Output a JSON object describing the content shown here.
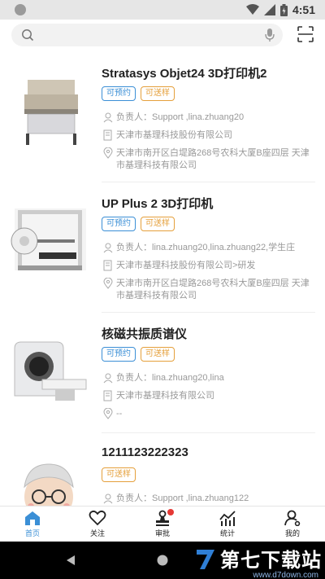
{
  "status_bar": {
    "time": "4:51"
  },
  "search": {
    "placeholder": ""
  },
  "items": [
    {
      "title": "Stratasys Objet24 3D打印机2",
      "tags": [
        {
          "label": "可预约",
          "kind": "blue"
        },
        {
          "label": "可送样",
          "kind": "orange"
        }
      ],
      "owner": "负责人：Support ,lina.zhuang20",
      "company": "天津市基理科技股份有限公司",
      "address": "天津市南开区白堤路268号农科大厦B座四层 天津市基理科技有限公司"
    },
    {
      "title": "UP Plus 2 3D打印机",
      "tags": [
        {
          "label": "可预约",
          "kind": "blue"
        },
        {
          "label": "可送样",
          "kind": "orange"
        }
      ],
      "owner": "负责人：lina.zhuang20,lina.zhuang22,学生庄",
      "company": "天津市基理科技股份有限公司>研发",
      "address": "天津市南开区白堤路268号农科大厦B座四层 天津市基理科技有限公司"
    },
    {
      "title": "核磁共振质谱仪",
      "tags": [
        {
          "label": "可预约",
          "kind": "blue"
        },
        {
          "label": "可送样",
          "kind": "orange"
        }
      ],
      "owner": "负责人：lina.zhuang20,lina",
      "company": "天津市基理科技有限公司",
      "address": "--"
    },
    {
      "title": "1211123222323",
      "tags": [
        {
          "label": "可送样",
          "kind": "orange"
        }
      ],
      "owner": "负责人：Support ,lina.zhuang122",
      "company": "",
      "address": ""
    }
  ],
  "tabs": [
    {
      "label": "首页",
      "icon": "home-icon",
      "active": true
    },
    {
      "label": "关注",
      "icon": "heart-icon",
      "active": false
    },
    {
      "label": "审批",
      "icon": "stamp-icon",
      "active": false,
      "badge": true
    },
    {
      "label": "统计",
      "icon": "chart-icon",
      "active": false
    },
    {
      "label": "我的",
      "icon": "user-icon",
      "active": false
    }
  ],
  "watermark": {
    "text": "第七下载站",
    "url": "www.d7down.com"
  },
  "colors": {
    "accent": "#3b8fd6",
    "orange": "#e5a03c",
    "badge": "#e53935"
  }
}
